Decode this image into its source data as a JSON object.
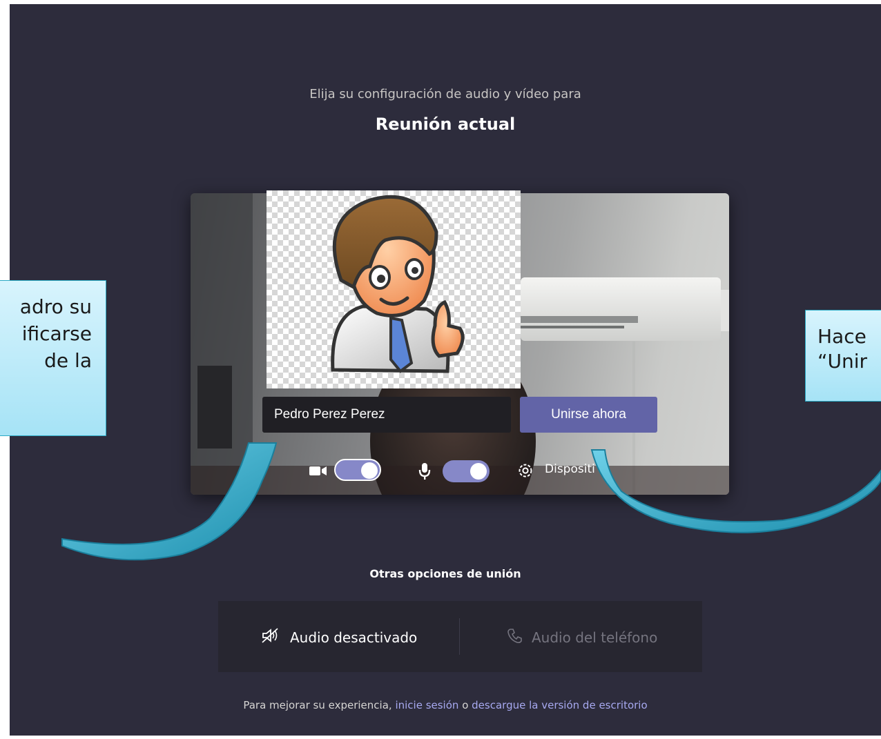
{
  "header": {
    "subtitle": "Elija su configuración de audio y vídeo para",
    "meeting_title": "Reunión actual"
  },
  "prejoin": {
    "name_value": "Pedro Perez Perez",
    "join_label": "Unirse ahora",
    "camera_on": true,
    "mic_on": true,
    "devices_label": "Dispositi"
  },
  "other_options": {
    "title": "Otras opciones de unión",
    "audio_off_label": "Audio desactivado",
    "phone_audio_label": "Audio del teléfono"
  },
  "footer": {
    "prefix": "Para mejorar su experiencia,",
    "signin_link": "inicie sesión",
    "connector": "o",
    "download_link": "descargue la versión de escritorio"
  },
  "annotations": {
    "left_lines": [
      "adro su",
      "ificarse",
      "de la"
    ],
    "right_lines": [
      "Hace",
      "“Unir"
    ]
  },
  "colors": {
    "background": "#2d2c3c",
    "accent": "#6264a7",
    "toggle": "#8688c8",
    "callout_fill": "#bde9f8",
    "callout_border": "#2aa9c4"
  }
}
